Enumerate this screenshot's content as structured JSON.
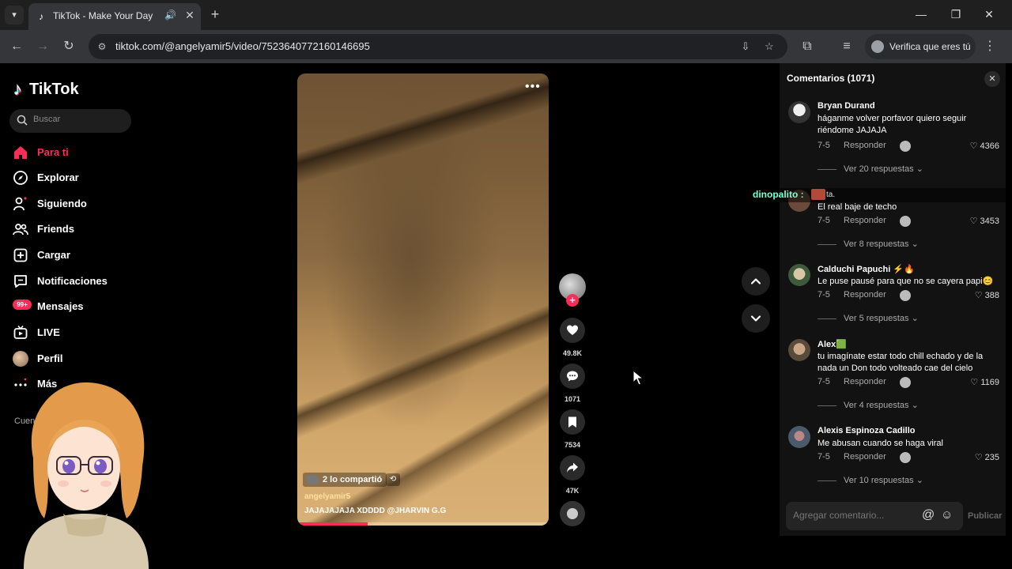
{
  "browser": {
    "tab_title": "TikTok - Make Your Day",
    "url": "tiktok.com/@angelyamir5/video/7523640772160146695",
    "verify_label": "Verifica que eres tú"
  },
  "sidebar": {
    "logo_text": "TikTok",
    "search_placeholder": "Buscar",
    "items": [
      {
        "label": "Para ti",
        "icon": "home-icon"
      },
      {
        "label": "Explorar",
        "icon": "compass-icon"
      },
      {
        "label": "Siguiendo",
        "icon": "following-icon"
      },
      {
        "label": "Friends",
        "icon": "friends-icon"
      },
      {
        "label": "Cargar",
        "icon": "upload-icon"
      },
      {
        "label": "Notificaciones",
        "icon": "notification-icon"
      },
      {
        "label": "Mensajes",
        "icon": "message-icon",
        "badge": "99+"
      },
      {
        "label": "LIVE",
        "icon": "live-icon"
      },
      {
        "label": "Perfil",
        "icon": "profile-avatar"
      },
      {
        "label": "Más",
        "icon": "more-icon"
      }
    ],
    "accounts_label": "Cuen"
  },
  "video": {
    "share_text": "2 lo compartió",
    "author": "angelyamir5",
    "caption": "JAJAJAJAJA XDDDD @JHARVIN G.G",
    "progress": 0.28
  },
  "actions": {
    "likes": "49.8K",
    "comments": "1071",
    "saves": "7534",
    "shares": "47K"
  },
  "comments_panel": {
    "title": "Comentarios (1071)",
    "reply_label": "Responder",
    "items": [
      {
        "user": "Bryan Durand",
        "text": "háganme volver porfavor quiero seguir riéndome JAJAJA",
        "date": "7-5",
        "likes": "4366",
        "replies": "Ver 20 respuestas"
      },
      {
        "user": "",
        "text": "El real baje de techo",
        "date": "7-5",
        "likes": "3453",
        "replies": "Ver 8 respuestas"
      },
      {
        "user": "Calduchi Papuchi ⚡🔥",
        "text": "Le puse pausé para que no se cayera papi😊",
        "date": "7-5",
        "likes": "388",
        "replies": "Ver 5 respuestas"
      },
      {
        "user": "Alex🟩",
        "text": "tu imagínate estar todo chill echado y de la nada un Don todo volteado cae del cielo",
        "date": "7-5",
        "likes": "1169",
        "replies": "Ver 4 respuestas"
      },
      {
        "user": "Alexis Espinoza Cadillo",
        "text": "Me abusan cuando se haga viral",
        "date": "7-5",
        "likes": "235",
        "replies": "Ver 10 respuestas"
      }
    ],
    "composer_placeholder": "Agregar comentario...",
    "publish_label": "Publicar"
  },
  "chat_overlay": {
    "name": "dinopalito :",
    "tail": "ta."
  },
  "colors": {
    "accent": "#fe2c55",
    "background": "#000000",
    "panel": "#121212"
  }
}
